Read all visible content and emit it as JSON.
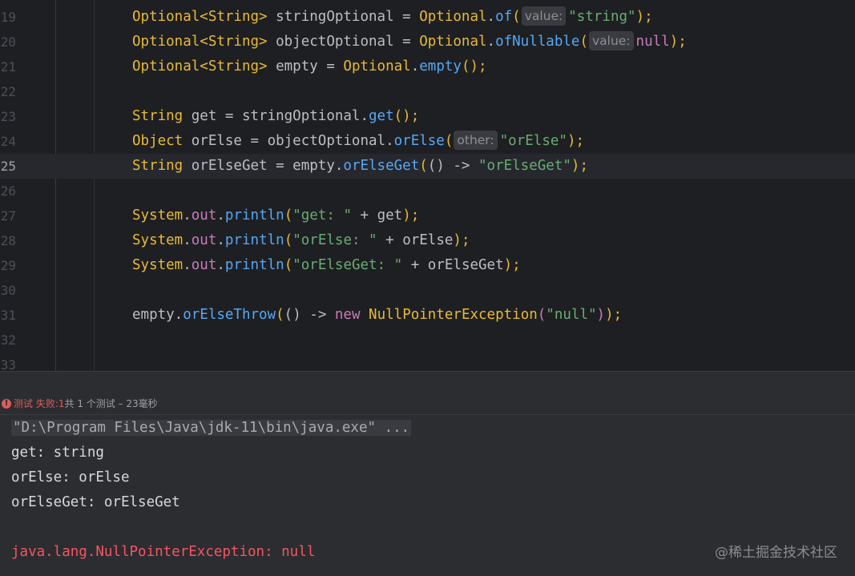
{
  "editor": {
    "lines": [
      {
        "num": "19",
        "t1": "Optional<String>",
        "t2": " stringOptional = ",
        "t3": "Optional",
        "t4": ".",
        "t5": "of",
        "t6": "(",
        "hint": "value:",
        "t7": "\"string\"",
        "t8": ");"
      },
      {
        "num": "20",
        "t1": "Optional<String>",
        "t2": " objectOptional = ",
        "t3": "Optional",
        "t4": ".",
        "t5": "ofNullable",
        "t6": "(",
        "hint": "value:",
        "t7": "null",
        "t8": ");"
      },
      {
        "num": "21",
        "t1": "Optional<String>",
        "t2": " empty = ",
        "t3": "Optional",
        "t4": ".",
        "t5": "empty",
        "t6": "();"
      },
      {
        "num": "22"
      },
      {
        "num": "23",
        "t1": "String",
        "t2": " get = stringOptional.",
        "t5": "get",
        "t6": "();"
      },
      {
        "num": "24",
        "t1": "Object",
        "t2": " orElse = objectOptional.",
        "t5": "orElse",
        "t6": "(",
        "hint": "other:",
        "t7": "\"orElse\"",
        "t8": ");"
      },
      {
        "num": "25",
        "t1": "String",
        "t2": " orElseGet = empty.",
        "t5": "orElseGet",
        "t6": "(",
        "t9": "() ->",
        "t7": " \"orElseGet\"",
        "t8": ");"
      },
      {
        "num": "26"
      },
      {
        "num": "27",
        "t1": "System",
        "t4": ".",
        "t10": "out",
        "t11": ".",
        "t5": "println",
        "t6": "(",
        "t7": "\"get: \"",
        "t2": " + get",
        "t8": ");"
      },
      {
        "num": "28",
        "t1": "System",
        "t4": ".",
        "t10": "out",
        "t11": ".",
        "t5": "println",
        "t6": "(",
        "t7": "\"orElse: \"",
        "t2": " + orElse",
        "t8": ");"
      },
      {
        "num": "29",
        "t1": "System",
        "t4": ".",
        "t10": "out",
        "t11": ".",
        "t5": "println",
        "t6": "(",
        "t7": "\"orElseGet: \"",
        "t2": " + orElseGet",
        "t8": ");"
      },
      {
        "num": "30"
      },
      {
        "num": "31",
        "t2": "empty.",
        "t5": "orElseThrow",
        "t6": "(",
        "t9": "() ->",
        "t12": " new",
        "t13": " NullPointerException",
        "t14": "(",
        "t7": "\"null\"",
        "t15": ")",
        "t8": ");"
      },
      {
        "num": "32"
      },
      {
        "num": "33"
      }
    ]
  },
  "status": {
    "label": "测试 失败:",
    "fail_count": "1",
    "total_word": "共",
    "summary": " 1 个测试 – 23毫秒"
  },
  "console": {
    "command": "\"D:\\Program Files\\Java\\jdk-11\\bin\\java.exe\" ...",
    "out1": "get: string",
    "out2": "orElse: orElse",
    "out3": "orElseGet: orElseGet",
    "error": "java.lang.NullPointerException: null"
  },
  "watermark": "@稀土掘金技术社区",
  "colors": {
    "keyword_type": "#e8ba36",
    "method": "#56a8f5",
    "string": "#6aab73",
    "error": "#f75464"
  }
}
